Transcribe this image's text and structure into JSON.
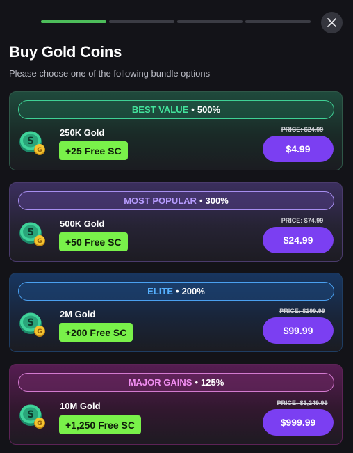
{
  "header": {
    "title": "Buy Gold Coins",
    "subtitle": "Please choose one of the following bundle options",
    "progress_steps": 4,
    "progress_active": 1,
    "close_icon": "close-icon"
  },
  "colors": {
    "accent_purple": "#7b3ff2",
    "bonus_green": "#79f14a",
    "progress_active": "#4dbd5a"
  },
  "bundles": [
    {
      "tag": "BEST VALUE",
      "dot": "•",
      "percent": "500%",
      "amount": "250K Gold",
      "bonus": "+25 Free SC",
      "old_price": "PRICE: $24.99",
      "price": "$4.99",
      "theme": "green",
      "icon": "coin-icon"
    },
    {
      "tag": "MOST POPULAR",
      "dot": "•",
      "percent": "300%",
      "amount": "500K Gold",
      "bonus": "+50 Free SC",
      "old_price": "PRICE: $74.99",
      "price": "$24.99",
      "theme": "purple",
      "icon": "coin-icon"
    },
    {
      "tag": "ELITE",
      "dot": "•",
      "percent": "200%",
      "amount": "2M Gold",
      "bonus": "+200 Free SC",
      "old_price": "PRICE: $199.99",
      "price": "$99.99",
      "theme": "blue",
      "icon": "coin-icon"
    },
    {
      "tag": "MAJOR GAINS",
      "dot": "•",
      "percent": "125%",
      "amount": "10M Gold",
      "bonus": "+1,250 Free SC",
      "old_price": "PRICE: $1,249.99",
      "price": "$999.99",
      "theme": "magenta",
      "icon": "coin-icon"
    }
  ]
}
